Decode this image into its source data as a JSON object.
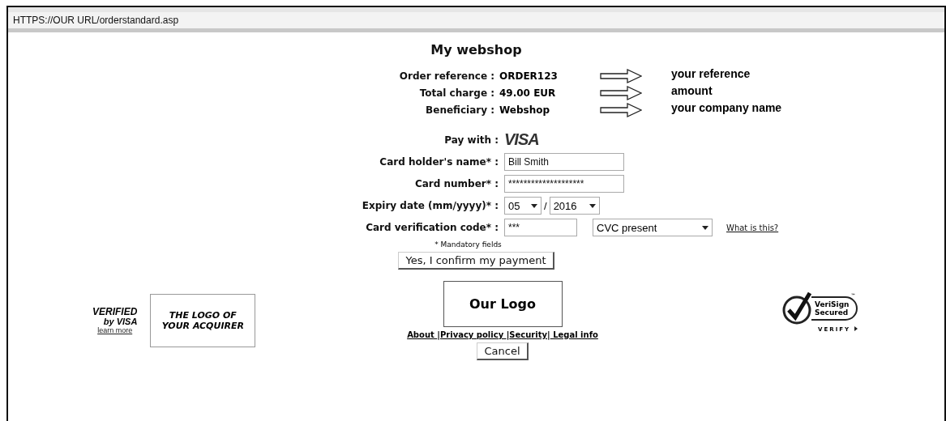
{
  "address_bar": {
    "url": "HTTPS://OUR URL/orderstandard.asp"
  },
  "title": "My webshop",
  "order_info": [
    {
      "label": "Order reference :",
      "value": "ORDER123",
      "note": "your reference"
    },
    {
      "label": "Total charge :",
      "value": "49.00 EUR",
      "note": "amount"
    },
    {
      "label": "Beneficiary :",
      "value": "Webshop",
      "note": "your company name"
    }
  ],
  "pay_with": {
    "label": "Pay with :",
    "brand": "VISA"
  },
  "fields": [
    {
      "kind": "text",
      "label": "Card holder's name* :",
      "value": "Bill Smith"
    },
    {
      "kind": "text",
      "label": "Card number* :",
      "value": "********************"
    },
    {
      "kind": "expiry",
      "label": "Expiry date (mm/yyyy)* :",
      "month": "05",
      "separator": "/",
      "year": "2016"
    },
    {
      "kind": "cvc",
      "label": "Card verification code* :",
      "value": "***",
      "option": "CVC present",
      "link": "What is this?"
    }
  ],
  "mandatory_note": "* Mandatory fields",
  "confirm_button": "Yes, I confirm my payment",
  "footer": {
    "verified_by_visa": {
      "line1": "VERIFIED",
      "line2": "by VISA",
      "link": "learn more"
    },
    "acquirer_logo": "THE LOGO OF YOUR ACQUIRER",
    "our_logo": "Our Logo",
    "links": [
      "About ",
      "Privacy policy ",
      "Security",
      " Legal info"
    ],
    "separator": "|",
    "cancel_button": "Cancel",
    "verisign": {
      "line1": "VeriSign",
      "line2": "Secured",
      "tm": "™",
      "verify": "VERIFY"
    }
  }
}
